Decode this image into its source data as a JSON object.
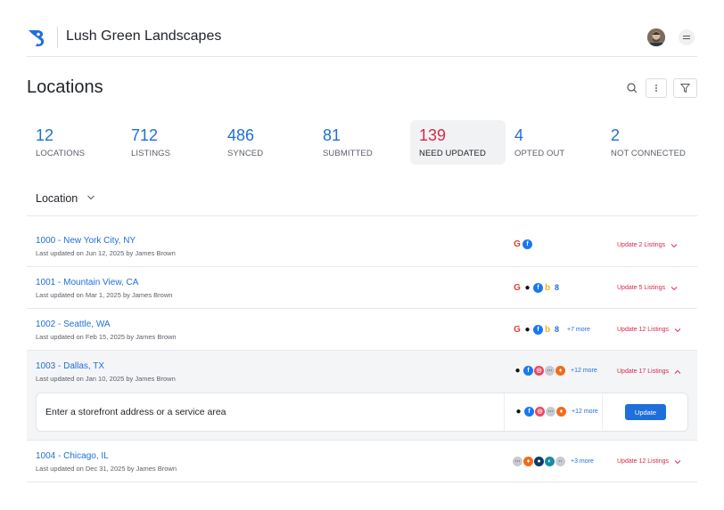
{
  "header": {
    "company": "Lush Green Landscapes",
    "accent": "#1e6fd9"
  },
  "page": {
    "title": "Locations"
  },
  "stats": [
    {
      "value": "12",
      "label": "LOCATIONS"
    },
    {
      "value": "712",
      "label": "LISTINGS"
    },
    {
      "value": "486",
      "label": "SYNCED"
    },
    {
      "value": "81",
      "label": "SUBMITTED"
    },
    {
      "value": "139",
      "label": "NEED UPDATED",
      "active": true
    },
    {
      "value": "4",
      "label": "OPTED OUT"
    },
    {
      "value": "2",
      "label": "NOT CONNECTED"
    }
  ],
  "table": {
    "column_label": "Location"
  },
  "rows": [
    {
      "title": "1000 - New York City, NY",
      "sub": "Last updated on Jun 12, 2025 by James Brown",
      "action": "Update 2 Listings",
      "more": ""
    },
    {
      "title": "1001 - Mountain View, CA",
      "sub": "Last updated on Mar 1, 2025 by James Brown",
      "action": "Update 5 Listings",
      "more": ""
    },
    {
      "title": "1002 - Seattle, WA",
      "sub": "Last updated on Feb 15, 2025 by James Brown",
      "action": "Update 12 Listings",
      "more": "+7 more"
    },
    {
      "title": "1003 - Dallas, TX",
      "sub": "Last updated on Jan 10, 2025 by James Brown",
      "action": "Update 17 Listings",
      "more": "+12 more"
    },
    {
      "title": "1004 - Chicago, IL",
      "sub": "Last updated on Dec 31, 2025 by James Brown",
      "action": "Update 12 Listings",
      "more": "+3 more"
    }
  ],
  "expanded": {
    "input_placeholder": "Enter a storefront address or a service area",
    "more": "+12 more",
    "button": "Update"
  },
  "colors": {
    "alert": "#d42a4a",
    "link": "#1e6fd9"
  }
}
